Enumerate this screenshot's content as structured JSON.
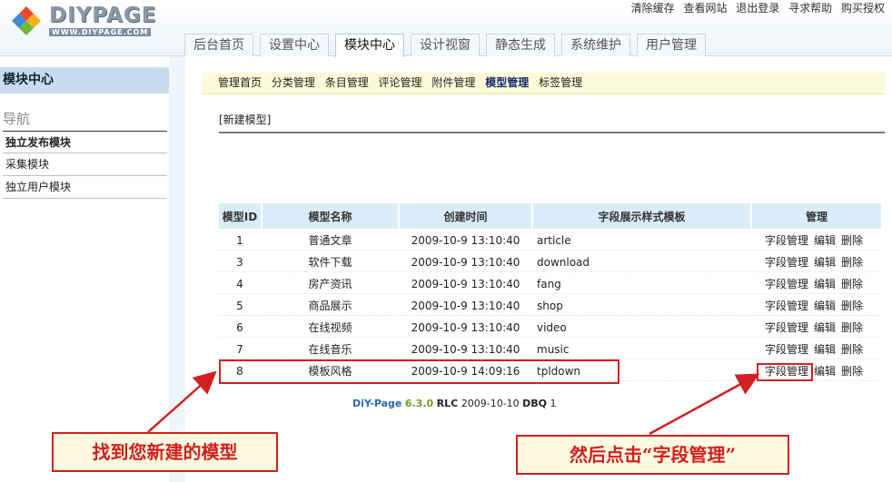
{
  "logo": {
    "text": "DIYPAGE",
    "sub": "WWW.DIYPAGE.COM"
  },
  "top_links": [
    "清除缓存",
    "查看网站",
    "退出登录",
    "寻求帮助",
    "购买授权"
  ],
  "tabs": [
    {
      "label": "后台首页",
      "active": false
    },
    {
      "label": "设置中心",
      "active": false
    },
    {
      "label": "模块中心",
      "active": true
    },
    {
      "label": "设计视窗",
      "active": false
    },
    {
      "label": "静态生成",
      "active": false
    },
    {
      "label": "系统维护",
      "active": false
    },
    {
      "label": "用户管理",
      "active": false
    }
  ],
  "sidebar": {
    "title": "模块中心",
    "nav_heading": "导航",
    "items": [
      "独立发布模块",
      "采集模块",
      "独立用户模块"
    ]
  },
  "subnav": {
    "items": [
      "管理首页",
      "分类管理",
      "条目管理",
      "评论管理",
      "附件管理",
      "模型管理",
      "标签管理"
    ],
    "active_index": 5
  },
  "new_model_link": "[新建模型]",
  "table": {
    "headers": [
      "模型ID",
      "模型名称",
      "创建时间",
      "字段展示样式模板",
      "管理"
    ],
    "actions": [
      "字段管理",
      "编辑",
      "删除"
    ],
    "rows": [
      {
        "id": "1",
        "name": "普通文章",
        "time": "2009-10-9 13:10:40",
        "tpl": "article"
      },
      {
        "id": "3",
        "name": "软件下载",
        "time": "2009-10-9 13:10:40",
        "tpl": "download"
      },
      {
        "id": "4",
        "name": "房产资讯",
        "time": "2009-10-9 13:10:40",
        "tpl": "fang"
      },
      {
        "id": "5",
        "name": "商品展示",
        "time": "2009-10-9 13:10:40",
        "tpl": "shop"
      },
      {
        "id": "6",
        "name": "在线视频",
        "time": "2009-10-9 13:10:40",
        "tpl": "video"
      },
      {
        "id": "7",
        "name": "在线音乐",
        "time": "2009-10-9 13:10:40",
        "tpl": "music"
      },
      {
        "id": "8",
        "name": "模板风格",
        "time": "2009-10-9 14:09:16",
        "tpl": "tpldown"
      }
    ]
  },
  "footer": {
    "product": "DiY-Page",
    "version": "6.3.0",
    "rlc_label": "RLC",
    "date": "2009-10-10",
    "dbq_label": "DBQ",
    "dbq": "1"
  },
  "annotations": {
    "callout_left": "找到您新建的模型",
    "callout_right": "然后点击“字段管理”",
    "color": "#d21f1f"
  }
}
